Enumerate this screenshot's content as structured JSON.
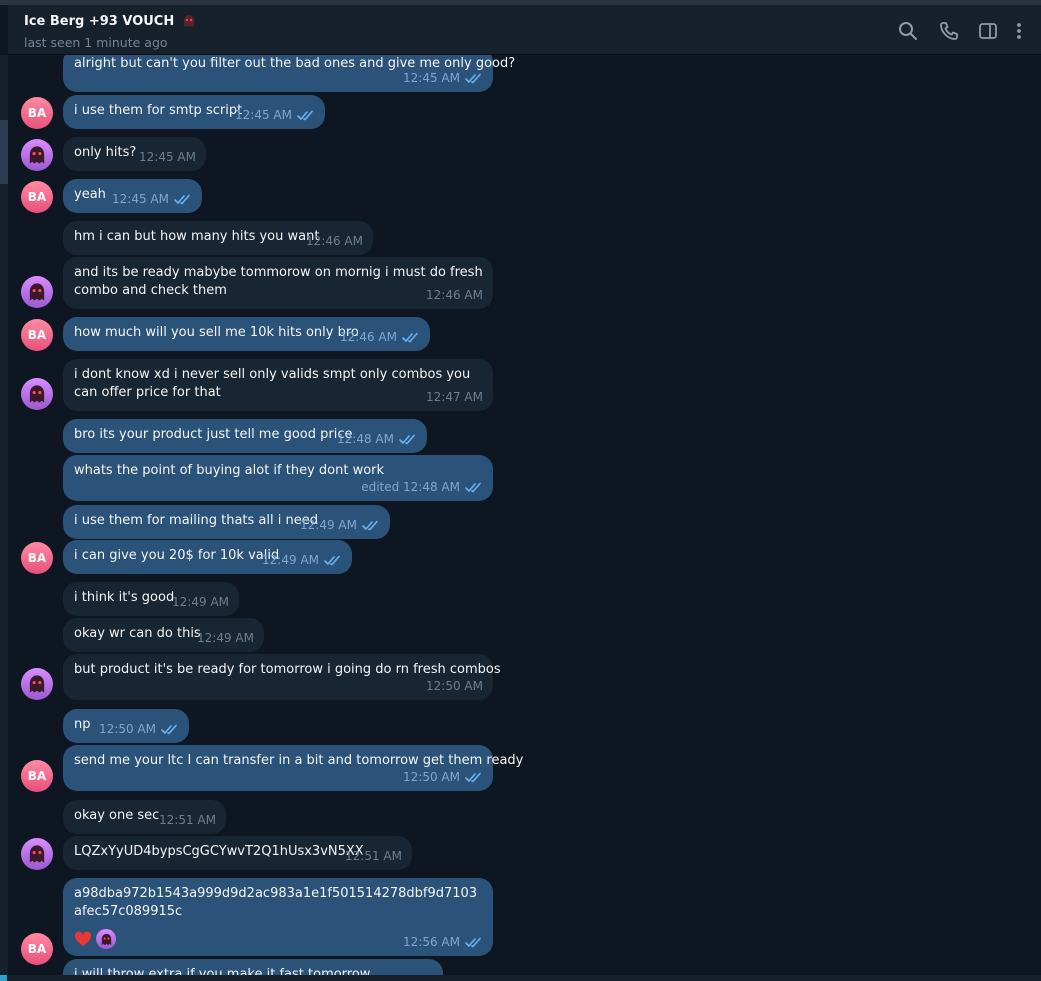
{
  "header": {
    "title": "Ice Berg +93 VOUCH",
    "status": "last seen 1 minute ago",
    "icons": [
      "search-icon",
      "phone-icon",
      "sidebar-toggle-icon",
      "more-vertical-icon"
    ]
  },
  "avatars": {
    "ba": "BA",
    "ghost": "ghost-avatar"
  },
  "colors": {
    "incoming": "#182533",
    "outgoing": "#2b5278",
    "background": "#0e1621",
    "ticks": "#6ab2f2"
  },
  "messages": [
    {
      "text": "alright but can't you filter out the bad ones and give me only good?",
      "time": "12:45 AM",
      "dir": "out"
    },
    {
      "text": "i use them for smtp script",
      "time": "12:45 AM",
      "dir": "out"
    },
    {
      "text": "only hits?",
      "time": "12:45 AM",
      "dir": "in"
    },
    {
      "text": "yeah",
      "time": "12:45 AM",
      "dir": "out"
    },
    {
      "text": "hm i can but how many hits you want",
      "time": "12:46 AM",
      "dir": "in"
    },
    {
      "text": "and its be ready mabybe tommorow on mornig i must do fresh combo and check them",
      "time": "12:46 AM",
      "dir": "in"
    },
    {
      "text": "how much will you sell me 10k hits only bro",
      "time": "12:46 AM",
      "dir": "out"
    },
    {
      "text": "i dont know xd i never sell only valids smpt only combos you can offer price for that",
      "time": "12:47 AM",
      "dir": "in"
    },
    {
      "text": "bro its your product just tell me good price",
      "time": "12:48 AM",
      "dir": "out"
    },
    {
      "text": "whats the point of buying alot if they dont work",
      "time": "edited 12:48 AM",
      "dir": "out"
    },
    {
      "text": "i use them for mailing thats all i need",
      "time": "12:49 AM",
      "dir": "out"
    },
    {
      "text": "i can give you 20$ for 10k valid",
      "time": "12:49 AM",
      "dir": "out"
    },
    {
      "text": "i think it's good",
      "time": "12:49 AM",
      "dir": "in"
    },
    {
      "text": "okay wr can do this",
      "time": "12:49 AM",
      "dir": "in"
    },
    {
      "text": "but product it's be ready for tomorrow i going do rn fresh combos",
      "time": "12:50 AM",
      "dir": "in"
    },
    {
      "text": "np",
      "time": "12:50 AM",
      "dir": "out"
    },
    {
      "text": "send me your ltc I can transfer in a bit and tomorrow get them ready",
      "time": "12:50 AM",
      "dir": "out"
    },
    {
      "text": "okay one sec",
      "time": "12:51 AM",
      "dir": "in"
    },
    {
      "text": "LQZxYyUD4bypsCgGCYwvT2Q1hUsx3vN5XX",
      "time": "12:51 AM",
      "dir": "in"
    },
    {
      "text": "a98dba972b1543a999d9d2ac983a1e1f501514278dbf9d7103afec57c089915c",
      "time": "12:56 AM",
      "dir": "out",
      "reactions": [
        "heart",
        "ghost-avatar"
      ]
    },
    {
      "text": "i will throw extra if you make it fast tomorrow",
      "time": "",
      "dir": "out"
    }
  ]
}
